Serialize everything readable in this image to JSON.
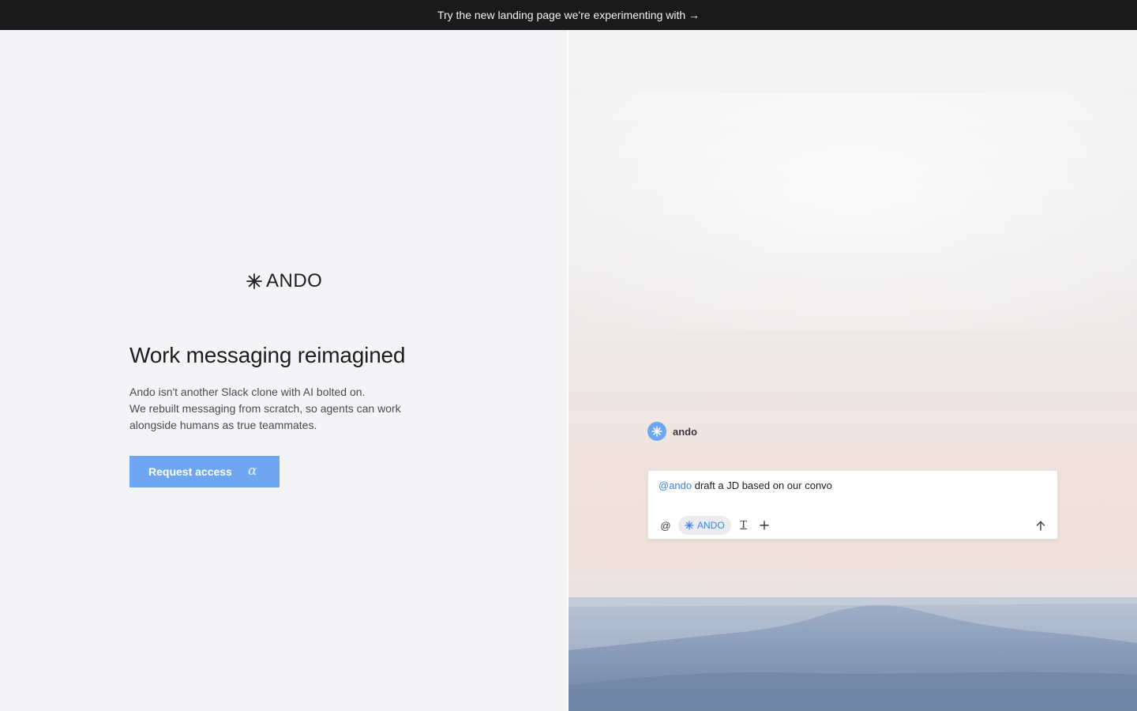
{
  "banner": {
    "text": "Try the new landing page we're experimenting with →"
  },
  "brand": {
    "name": "ANDO",
    "icon": "asterisk-icon"
  },
  "hero": {
    "headline": "Work messaging reimagined",
    "lines": [
      "Ando isn't another Slack clone with AI bolted on.",
      "We rebuilt messaging from scratch, so agents can work",
      "alongside humans as true teammates."
    ],
    "cta_label": "Request access",
    "cta_badge": "α"
  },
  "chat": {
    "agent_name": "ando",
    "composer": {
      "mention": "@ando",
      "message": " draft a JD based on our convo",
      "toolbar": {
        "at_label": "@",
        "chip_label": "ANDO",
        "format_label": "T",
        "add_label": "+"
      }
    }
  },
  "colors": {
    "accent": "#6ea6f1",
    "mention": "#3e84e0",
    "banner_bg": "#1a1a1a"
  }
}
